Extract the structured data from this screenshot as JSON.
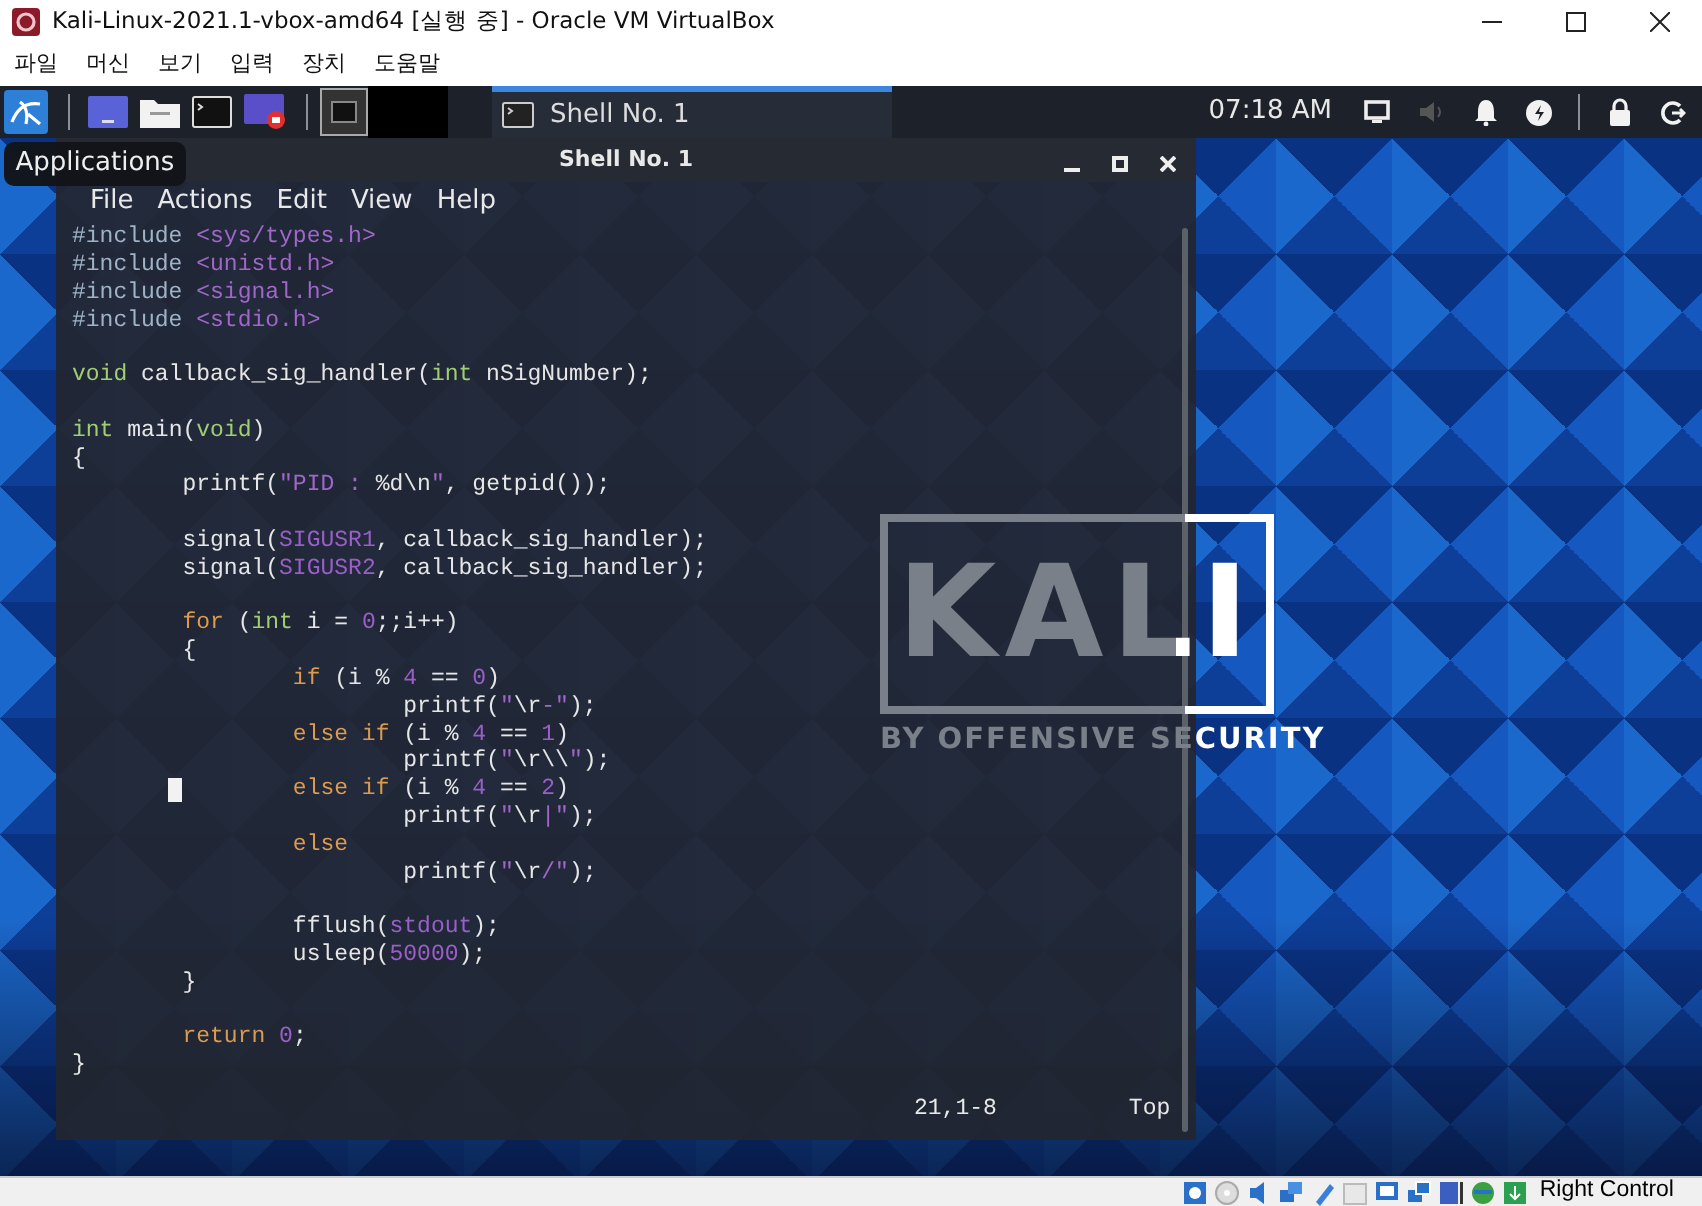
{
  "window": {
    "title": "Kali-Linux-2021.1-vbox-amd64 [실행 중] - Oracle VM VirtualBox"
  },
  "menu": [
    "파일",
    "머신",
    "보기",
    "입력",
    "장치",
    "도움말"
  ],
  "panel": {
    "tasks": [
      {
        "label": "Shell No. 1",
        "selected": true
      }
    ],
    "clock": "07:18 AM"
  },
  "tooltip": "Applications",
  "desktop": {
    "logo_text": "KALI",
    "logo_subtitle": "BY OFFENSIVE SECURITY"
  },
  "terminal": {
    "title": "Shell No. 1",
    "menu": [
      "File",
      "Actions",
      "Edit",
      "View",
      "Help"
    ],
    "lines": [
      {
        "kind": "code",
        "tokens": [
          {
            "kind": "pre",
            "text": "#include "
          },
          {
            "kind": "str",
            "text": "<sys/types.h>"
          }
        ]
      },
      {
        "kind": "code",
        "tokens": [
          {
            "kind": "pre",
            "text": "#include "
          },
          {
            "kind": "str",
            "text": "<unistd.h>"
          }
        ]
      },
      {
        "kind": "code",
        "tokens": [
          {
            "kind": "pre",
            "text": "#include "
          },
          {
            "kind": "str",
            "text": "<signal.h>"
          }
        ]
      },
      {
        "kind": "code",
        "tokens": [
          {
            "kind": "pre",
            "text": "#include "
          },
          {
            "kind": "str",
            "text": "<stdio.h>"
          }
        ]
      },
      {
        "kind": "blank"
      },
      {
        "kind": "code",
        "tokens": [
          {
            "kind": "type",
            "text": "void"
          },
          {
            "kind": "plain",
            "text": " callback_sig_handler("
          },
          {
            "kind": "type",
            "text": "int"
          },
          {
            "kind": "plain",
            "text": " nSigNumber);"
          }
        ]
      },
      {
        "kind": "blank"
      },
      {
        "kind": "code",
        "tokens": [
          {
            "kind": "type",
            "text": "int"
          },
          {
            "kind": "plain",
            "text": " main("
          },
          {
            "kind": "type",
            "text": "void"
          },
          {
            "kind": "plain",
            "text": ")"
          }
        ]
      },
      {
        "kind": "code",
        "tokens": [
          {
            "kind": "plain",
            "text": "{"
          }
        ]
      },
      {
        "kind": "code",
        "tokens": [
          {
            "kind": "plain",
            "text": "        printf("
          },
          {
            "kind": "str",
            "text": "\"PID : "
          },
          {
            "kind": "plain",
            "text": "%d\\n"
          },
          {
            "kind": "str",
            "text": "\""
          },
          {
            "kind": "plain",
            "text": ", getpid());"
          }
        ]
      },
      {
        "kind": "blank"
      },
      {
        "kind": "code",
        "tokens": [
          {
            "kind": "plain",
            "text": "        signal("
          },
          {
            "kind": "num",
            "text": "SIGUSR1"
          },
          {
            "kind": "plain",
            "text": ", callback_sig_handler);"
          }
        ]
      },
      {
        "kind": "code",
        "tokens": [
          {
            "kind": "plain",
            "text": "        signal("
          },
          {
            "kind": "num",
            "text": "SIGUSR2"
          },
          {
            "kind": "plain",
            "text": ", callback_sig_handler);"
          }
        ]
      },
      {
        "kind": "blank"
      },
      {
        "kind": "code",
        "tokens": [
          {
            "kind": "kw",
            "text": "        for"
          },
          {
            "kind": "plain",
            "text": " ("
          },
          {
            "kind": "type",
            "text": "int"
          },
          {
            "kind": "plain",
            "text": " i = "
          },
          {
            "kind": "num",
            "text": "0"
          },
          {
            "kind": "plain",
            "text": ";;i++)"
          }
        ]
      },
      {
        "kind": "code",
        "tokens": [
          {
            "kind": "plain",
            "text": "        {"
          }
        ]
      },
      {
        "kind": "code",
        "tokens": [
          {
            "kind": "kw",
            "text": "                if"
          },
          {
            "kind": "plain",
            "text": " (i % "
          },
          {
            "kind": "num",
            "text": "4"
          },
          {
            "kind": "plain",
            "text": " == "
          },
          {
            "kind": "num",
            "text": "0"
          },
          {
            "kind": "plain",
            "text": ")"
          }
        ]
      },
      {
        "kind": "code",
        "tokens": [
          {
            "kind": "plain",
            "text": "                        printf("
          },
          {
            "kind": "str",
            "text": "\""
          },
          {
            "kind": "plain",
            "text": "\\r"
          },
          {
            "kind": "str",
            "text": "-\""
          },
          {
            "kind": "plain",
            "text": ");"
          }
        ]
      },
      {
        "kind": "code",
        "tokens": [
          {
            "kind": "kw",
            "text": "                else if"
          },
          {
            "kind": "plain",
            "text": " (i % "
          },
          {
            "kind": "num",
            "text": "4"
          },
          {
            "kind": "plain",
            "text": " == "
          },
          {
            "kind": "num",
            "text": "1"
          },
          {
            "kind": "plain",
            "text": ")"
          }
        ]
      },
      {
        "kind": "code",
        "tokens": [
          {
            "kind": "plain",
            "text": "                        printf("
          },
          {
            "kind": "str",
            "text": "\""
          },
          {
            "kind": "plain",
            "text": "\\r\\\\"
          },
          {
            "kind": "str",
            "text": "\""
          },
          {
            "kind": "plain",
            "text": ");"
          }
        ]
      },
      {
        "kind": "code",
        "cursor": true,
        "tokens": [
          {
            "kind": "kw",
            "text": "                else if"
          },
          {
            "kind": "plain",
            "text": " (i % "
          },
          {
            "kind": "num",
            "text": "4"
          },
          {
            "kind": "plain",
            "text": " == "
          },
          {
            "kind": "num",
            "text": "2"
          },
          {
            "kind": "plain",
            "text": ")"
          }
        ]
      },
      {
        "kind": "code",
        "tokens": [
          {
            "kind": "plain",
            "text": "                        printf("
          },
          {
            "kind": "str",
            "text": "\""
          },
          {
            "kind": "plain",
            "text": "\\r"
          },
          {
            "kind": "str",
            "text": "|\""
          },
          {
            "kind": "plain",
            "text": ");"
          }
        ]
      },
      {
        "kind": "code",
        "tokens": [
          {
            "kind": "kw",
            "text": "                else"
          }
        ]
      },
      {
        "kind": "code",
        "tokens": [
          {
            "kind": "plain",
            "text": "                        printf("
          },
          {
            "kind": "str",
            "text": "\""
          },
          {
            "kind": "plain",
            "text": "\\r"
          },
          {
            "kind": "str",
            "text": "/\""
          },
          {
            "kind": "plain",
            "text": ");"
          }
        ]
      },
      {
        "kind": "blank"
      },
      {
        "kind": "code",
        "tokens": [
          {
            "kind": "plain",
            "text": "                fflush("
          },
          {
            "kind": "num",
            "text": "stdout"
          },
          {
            "kind": "plain",
            "text": ");"
          }
        ]
      },
      {
        "kind": "code",
        "tokens": [
          {
            "kind": "plain",
            "text": "                usleep("
          },
          {
            "kind": "num",
            "text": "50000"
          },
          {
            "kind": "plain",
            "text": ");"
          }
        ]
      },
      {
        "kind": "code",
        "tokens": [
          {
            "kind": "plain",
            "text": "        }"
          }
        ]
      },
      {
        "kind": "blank"
      },
      {
        "kind": "code",
        "tokens": [
          {
            "kind": "kw",
            "text": "        return"
          },
          {
            "kind": "num",
            "text": " 0"
          },
          {
            "kind": "plain",
            "text": ";"
          }
        ]
      },
      {
        "kind": "code",
        "tokens": [
          {
            "kind": "plain",
            "text": "}"
          }
        ]
      }
    ],
    "position": "21,1-8",
    "scroll": "Top"
  },
  "status_bar": {
    "host_key": "Right Control"
  }
}
